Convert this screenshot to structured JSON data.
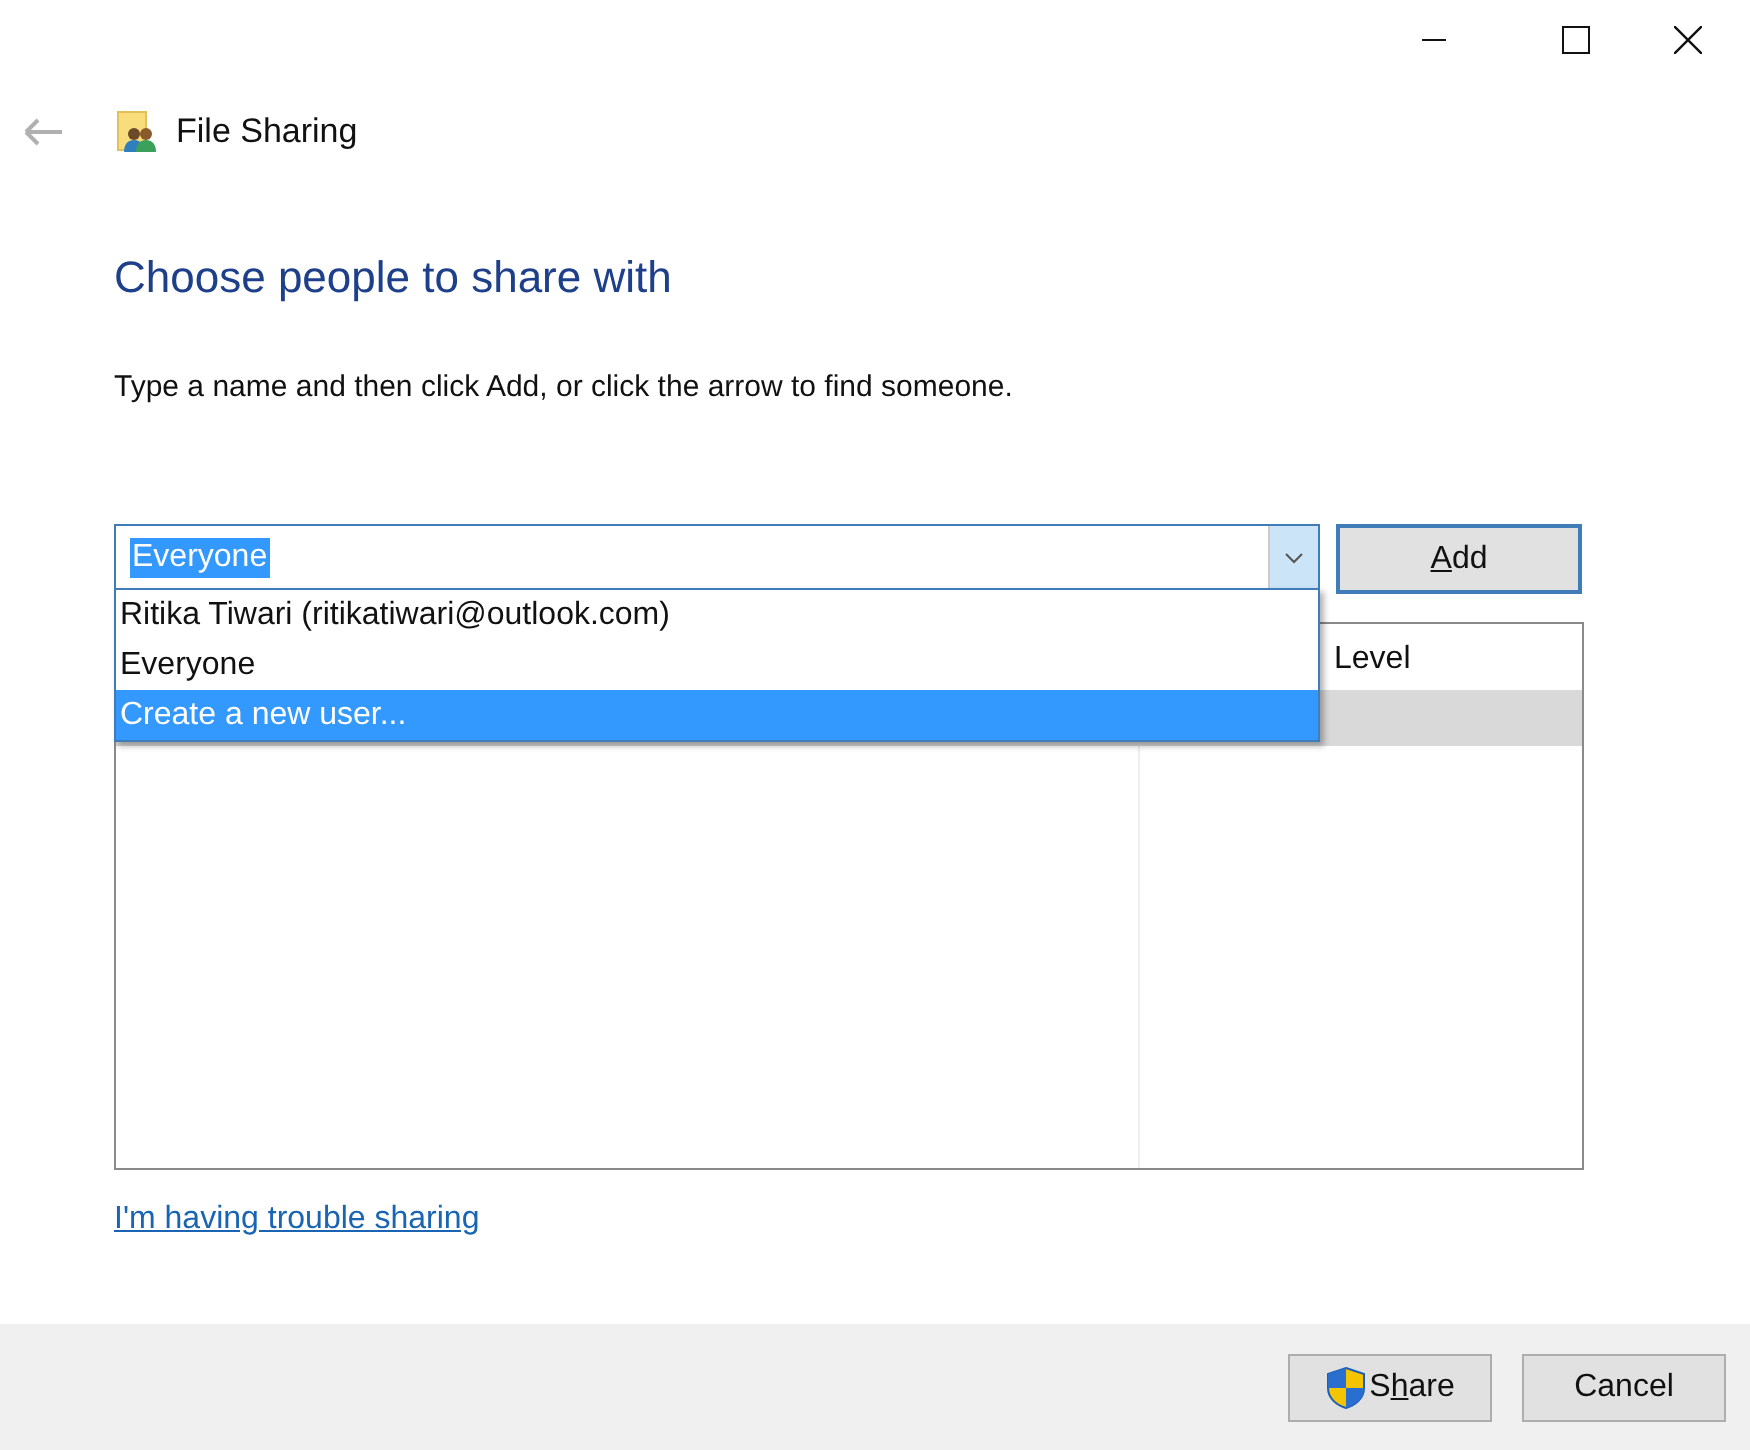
{
  "window": {
    "title": "File Sharing"
  },
  "heading": "Choose people to share with",
  "instruction": "Type a name and then click Add, or click the arrow to find someone.",
  "combo": {
    "value": "Everyone",
    "value_selected": true,
    "expanded": true
  },
  "dropdown": {
    "items": [
      {
        "label": "Ritika Tiwari (ritikatiwari@outlook.com)",
        "selected": false
      },
      {
        "label": "Everyone",
        "selected": false
      },
      {
        "label": "Create a new user...",
        "selected": true
      }
    ]
  },
  "add_button": {
    "access_key": "A",
    "rest": "dd"
  },
  "table": {
    "columns": [
      "Level"
    ],
    "rows": [
      {
        "selected": true
      }
    ]
  },
  "help_link": "I'm having trouble sharing",
  "buttons": [
    {
      "kind": "shield",
      "before": "S",
      "access_key": "h",
      "rest": "are"
    },
    {
      "kind": "plain",
      "before": "Cancel"
    }
  ]
}
